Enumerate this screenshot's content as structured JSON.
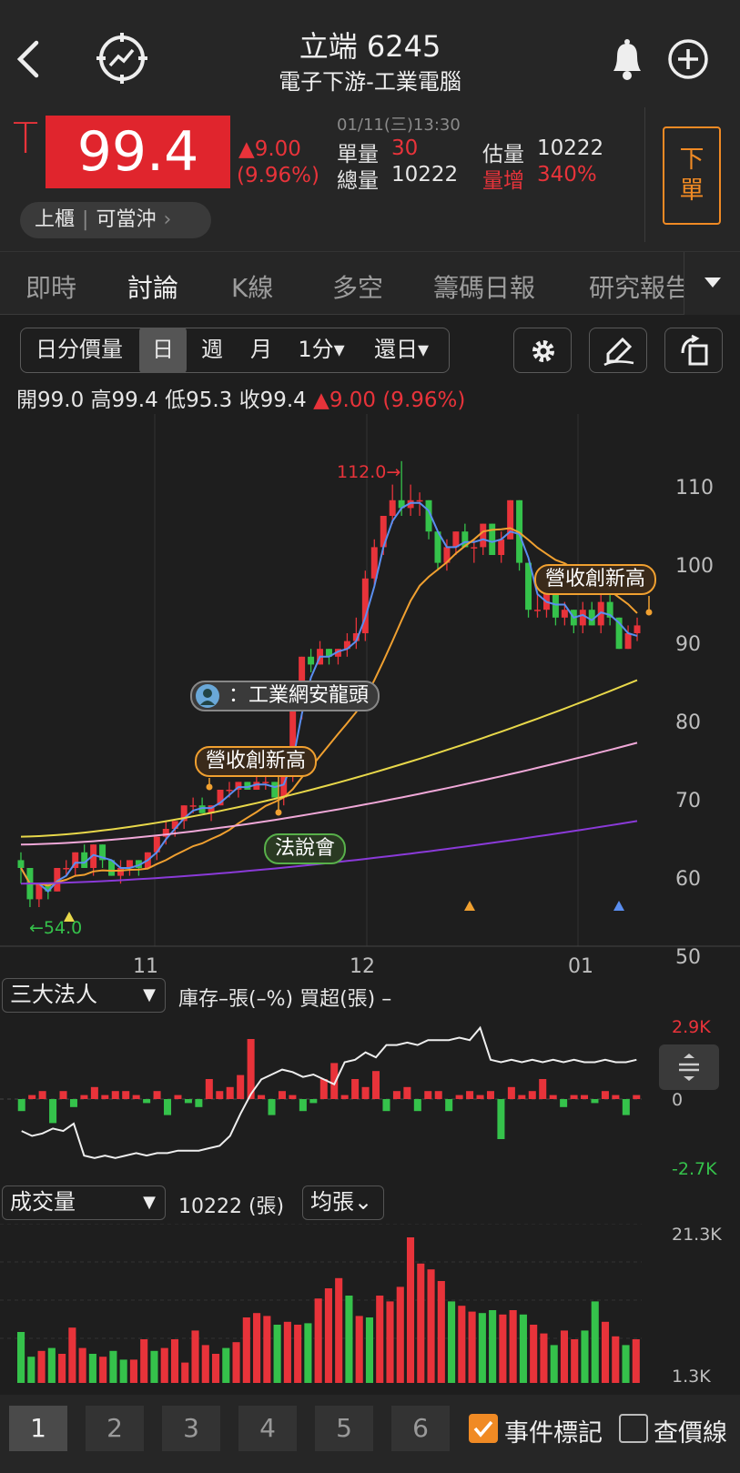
{
  "header": {
    "title": "立端 6245",
    "subtitle": "電子下游-工業電腦",
    "back_icon": "chevron-left-icon",
    "radar_icon": "crosshair-trend-icon",
    "bell_icon": "bell-icon",
    "add_icon": "plus-circle-icon"
  },
  "quote": {
    "limit_mark": "T",
    "price": "99.4",
    "change": "▲9.00",
    "change_pct": "(9.96%)",
    "datetime": "01/11(三)13:30",
    "unit_label": "單量",
    "unit_value": "30",
    "total_label": "總量",
    "total_value": "10222",
    "est_label": "估量",
    "est_value": "10222",
    "vol_inc_label": "量增",
    "vol_inc_value": "340%",
    "market": "上櫃",
    "daytrade": "可當沖",
    "order_label_1": "下",
    "order_label_2": "單"
  },
  "tabs": [
    "即時",
    "討論",
    "K線",
    "多空",
    "籌碼日報",
    "研究報告"
  ],
  "toolbar": {
    "mode": "日分價量",
    "d": "日",
    "w": "週",
    "m": "月",
    "min": "1分▾",
    "restore": "還日▾"
  },
  "ohlc": {
    "open": "開99.0",
    "high": "高99.4",
    "low": "低95.3",
    "close": "收99.4",
    "chg": "▲9.00 (9.96%)"
  },
  "chart_data": {
    "type": "candlestick",
    "ylim": [
      50,
      112
    ],
    "yticks": [
      "110",
      "100",
      "90",
      "80",
      "70",
      "60",
      "50"
    ],
    "xticks": [
      "11",
      "12",
      "01"
    ],
    "max_label": "112.0→",
    "min_label": "←54.0",
    "candles": [
      [
        61,
        62,
        58,
        60
      ],
      [
        60,
        60,
        55,
        56
      ],
      [
        56,
        58,
        55,
        58
      ],
      [
        58,
        58,
        56,
        57
      ],
      [
        57,
        60,
        57,
        60
      ],
      [
        60,
        61,
        59,
        60
      ],
      [
        60,
        62,
        59,
        62
      ],
      [
        62,
        63,
        60,
        60
      ],
      [
        60,
        63,
        59,
        63
      ],
      [
        63,
        63,
        60,
        61
      ],
      [
        61,
        61,
        59,
        59
      ],
      [
        59,
        61,
        58,
        60
      ],
      [
        60,
        61,
        59,
        61
      ],
      [
        61,
        61,
        59,
        60
      ],
      [
        60,
        62,
        60,
        62
      ],
      [
        62,
        64,
        61,
        64
      ],
      [
        64,
        66,
        63,
        65
      ],
      [
        65,
        66,
        64,
        66
      ],
      [
        66,
        68,
        65,
        68
      ],
      [
        68,
        69,
        67,
        68
      ],
      [
        68,
        69,
        67,
        67
      ],
      [
        67,
        68,
        66,
        68
      ],
      [
        68,
        70,
        68,
        70
      ],
      [
        70,
        71,
        69,
        70
      ],
      [
        70,
        71,
        69,
        71
      ],
      [
        71,
        71,
        70,
        70
      ],
      [
        70,
        72,
        70,
        71
      ],
      [
        71,
        72,
        70,
        71
      ],
      [
        71,
        71,
        69,
        69
      ],
      [
        69,
        72,
        68,
        72
      ],
      [
        72,
        80,
        71,
        80
      ],
      [
        80,
        87,
        79,
        87
      ],
      [
        87,
        88,
        85,
        86
      ],
      [
        86,
        89,
        86,
        88
      ],
      [
        88,
        88,
        86,
        87
      ],
      [
        87,
        88,
        86,
        88
      ],
      [
        88,
        90,
        87,
        89
      ],
      [
        89,
        92,
        88,
        90
      ],
      [
        90,
        98,
        89,
        97
      ],
      [
        97,
        102,
        96,
        101
      ],
      [
        101,
        105,
        100,
        105
      ],
      [
        105,
        109,
        104,
        107
      ],
      [
        107,
        112,
        105,
        106
      ],
      [
        106,
        109,
        105,
        107
      ],
      [
        107,
        108,
        105,
        107
      ],
      [
        107,
        107,
        102,
        103
      ],
      [
        103,
        103,
        98,
        99
      ],
      [
        99,
        102,
        98,
        101
      ],
      [
        101,
        103,
        100,
        103
      ],
      [
        103,
        104,
        101,
        101
      ],
      [
        101,
        102,
        99,
        101
      ],
      [
        101,
        104,
        100,
        104
      ],
      [
        104,
        104,
        100,
        100
      ],
      [
        100,
        103,
        99,
        102
      ],
      [
        102,
        107,
        102,
        107
      ],
      [
        107,
        107,
        98,
        99
      ],
      [
        99,
        99,
        92,
        93
      ],
      [
        93,
        95,
        92,
        93
      ],
      [
        93,
        97,
        92,
        96
      ],
      [
        96,
        96,
        91,
        92
      ],
      [
        92,
        94,
        91,
        93
      ],
      [
        93,
        93,
        90,
        91
      ],
      [
        91,
        94,
        90,
        93
      ],
      [
        93,
        94,
        91,
        91
      ],
      [
        91,
        95,
        90,
        94
      ],
      [
        94,
        95,
        91,
        92
      ],
      [
        92,
        92,
        88,
        88
      ],
      [
        88,
        91,
        88,
        90
      ],
      [
        90,
        92,
        89,
        91
      ]
    ],
    "annotations": [
      "營收創新高",
      "：工業網安龍頭",
      "法說會",
      "營收創新高"
    ],
    "inst": {
      "label": "三大法人",
      "info": "庫存–張(–%)  買超(張) –",
      "ymax": "2.9K",
      "ymid": "0",
      "ymin": "-2.7K"
    },
    "volume": {
      "label": "成交量",
      "value": "10222 (張)",
      "avg": "均張⌄",
      "ymax": "21.3K",
      "ymin": "1.3K"
    }
  },
  "colors": {
    "up": "#e8333a",
    "down": "#35c24b",
    "ma5": "#5a8ef0",
    "ma20": "#f0a030",
    "ma60": "#e8d84a",
    "ma120": "#f0a8d8",
    "ma240": "#8a3ad8"
  },
  "bottom": {
    "pages": [
      "1",
      "2",
      "3",
      "4",
      "5",
      "6"
    ],
    "event": "事件標記",
    "lookup": "查價線"
  }
}
